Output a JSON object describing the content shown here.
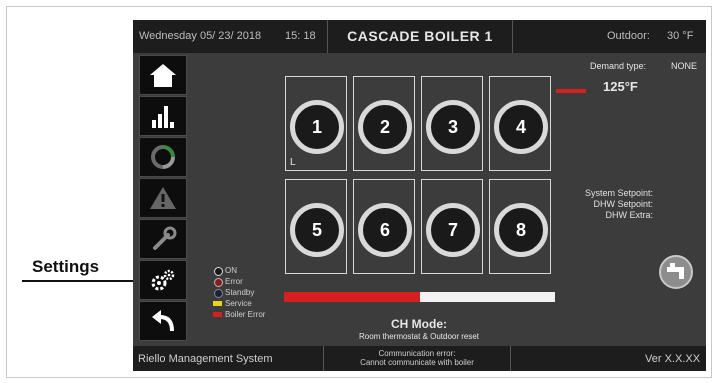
{
  "topbar": {
    "date": "Wednesday 05/ 23/ 2018",
    "time": "15: 18",
    "title": "CASCADE BOILER  1",
    "outdoor_label": "Outdoor:",
    "outdoor_value": "30 °F"
  },
  "sidebar": {
    "items": [
      {
        "icon": "home-icon"
      },
      {
        "icon": "bar-chart-icon"
      },
      {
        "icon": "refresh-icon"
      },
      {
        "icon": "warning-icon"
      },
      {
        "icon": "wrench-icon"
      },
      {
        "icon": "gears-icon"
      },
      {
        "icon": "back-arrow-icon"
      }
    ]
  },
  "boilers": [
    {
      "number": "1",
      "mark": "L"
    },
    {
      "number": "2"
    },
    {
      "number": "3"
    },
    {
      "number": "4"
    },
    {
      "number": "5"
    },
    {
      "number": "6"
    },
    {
      "number": "7"
    },
    {
      "number": "8"
    }
  ],
  "status": {
    "demand_label": "Demand type:",
    "demand_value": "NONE",
    "temperature": "125°F",
    "system_setpoint_label": "System Setpoint:",
    "dhw_setpoint_label": "DHW Setpoint:",
    "dhw_extra_label": "DHW Extra:"
  },
  "legend": [
    {
      "label": "ON",
      "color": "#1a1a1a",
      "kind": "dot"
    },
    {
      "label": "Error",
      "color": "#8b1a1a",
      "kind": "dot"
    },
    {
      "label": "Standby",
      "color": "#1a1f3a",
      "kind": "dot"
    },
    {
      "label": "Service",
      "color": "#e6d31a",
      "kind": "bar"
    },
    {
      "label": "Boiler Error",
      "color": "#d62020",
      "kind": "bar"
    }
  ],
  "progress": {
    "fraction": 0.5
  },
  "ch_mode": {
    "title": "CH Mode:",
    "subtitle": "Room thermostat & Outdoor reset"
  },
  "bottombar": {
    "left": "Riello Management System",
    "mid_line1": "Communication error:",
    "mid_line2": "Cannot communicate with boiler",
    "version": "Ver X.X.XX"
  },
  "callout": {
    "label": "Settings"
  }
}
